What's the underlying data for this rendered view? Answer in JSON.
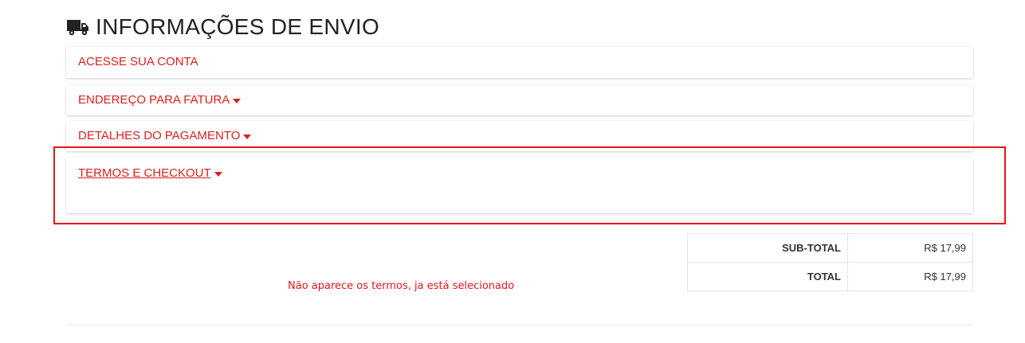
{
  "header": {
    "icon": "truck-icon",
    "title": "INFORMAÇÕES DE ENVIO"
  },
  "panels": [
    {
      "title": "ACESSE SUA CONTA",
      "caret": false
    },
    {
      "title": "ENDEREÇO PARA FATURA",
      "caret": true
    },
    {
      "title": "DETALHES DO PAGAMENTO",
      "caret": true
    },
    {
      "title": "TERMOS E CHECKOUT",
      "caret": true
    }
  ],
  "totals": [
    {
      "label": "SUB-TOTAL",
      "value": "R$ 17,99"
    },
    {
      "label": "TOTAL",
      "value": "R$ 17,99"
    }
  ],
  "annotation": {
    "note": "Não aparece os termos, ja está selecionado",
    "highlight_color": "#e5151a"
  },
  "colors": {
    "accent": "#d9211e",
    "heading": "#222222"
  }
}
